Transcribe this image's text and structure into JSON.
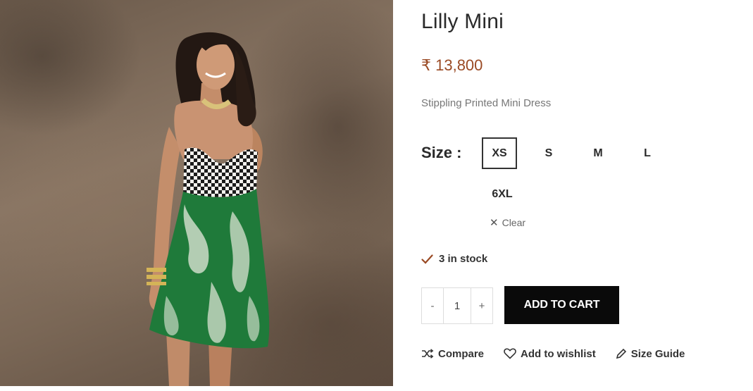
{
  "product": {
    "title": "Lilly Mini",
    "price": "₹ 13,800",
    "short_description": "Stippling Printed Mini Dress",
    "image_alt": "Lilly Mini"
  },
  "size_selector": {
    "label": "Size :",
    "options": [
      "XS",
      "S",
      "M",
      "L",
      "6XL"
    ],
    "selected": "XS",
    "clear_label": "Clear"
  },
  "stock": {
    "text": "3 in stock"
  },
  "quantity": {
    "minus": "-",
    "value": "1",
    "plus": "+"
  },
  "add_to_cart": {
    "label": "ADD TO CART"
  },
  "actions": {
    "compare": "Compare",
    "wishlist": "Add to wishlist",
    "size_guide": "Size Guide"
  },
  "colors": {
    "price": "#9a4a24",
    "button_bg": "#0a0a0a",
    "stock_check": "#9a4a24"
  }
}
